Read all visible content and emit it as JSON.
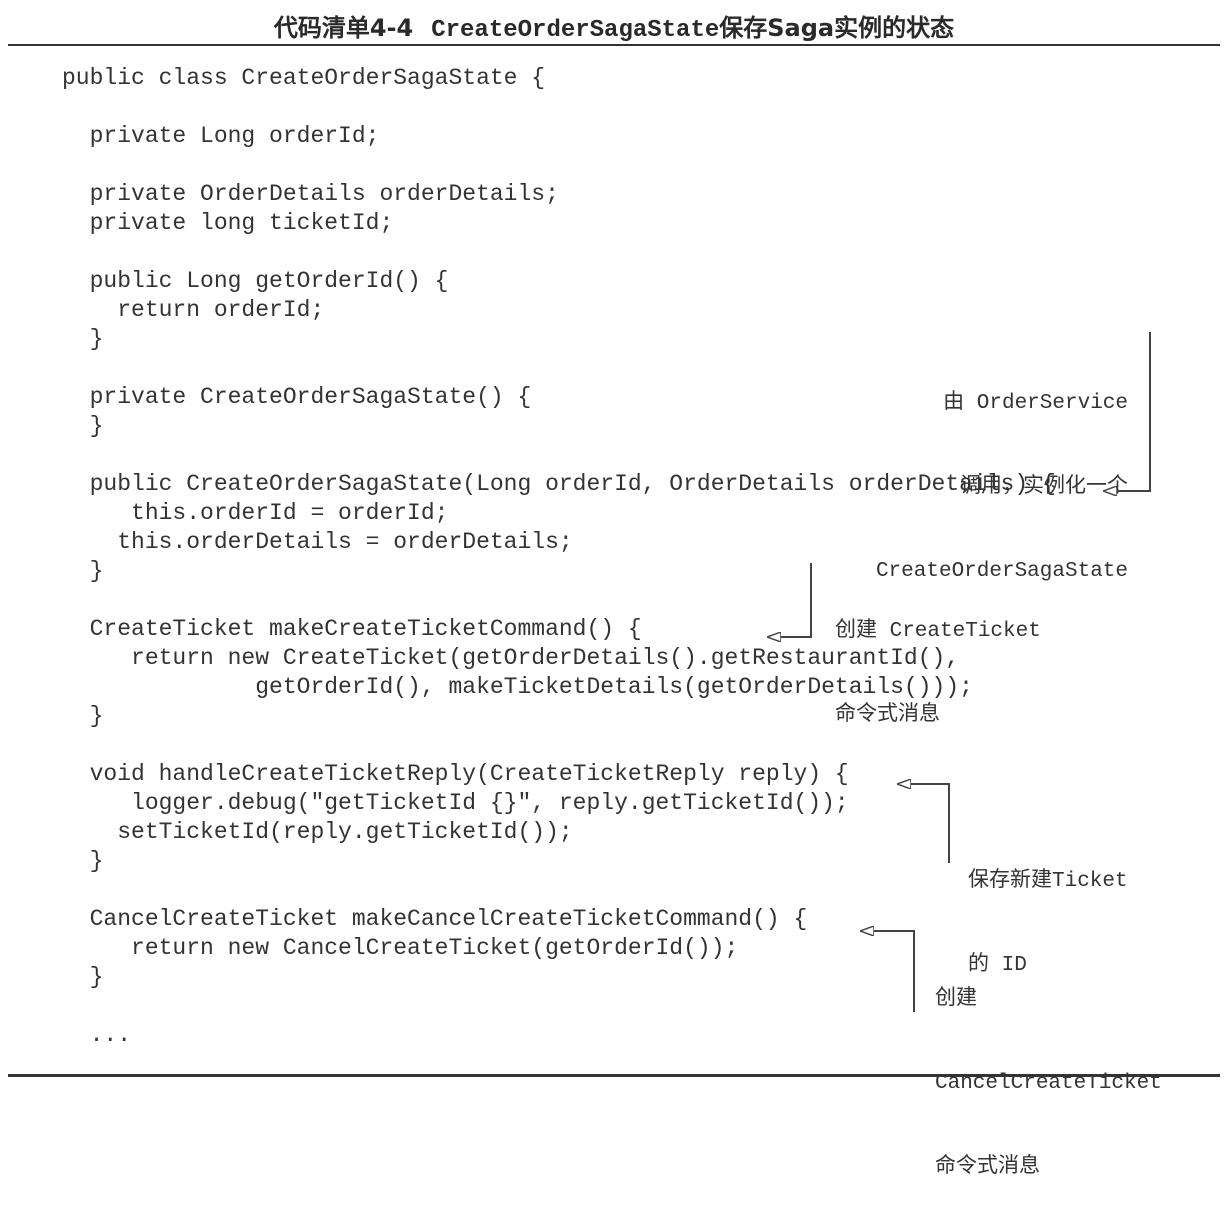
{
  "title": {
    "prefix": "代码清单4-4",
    "classname": "CreateOrderSagaState",
    "suffix_a": "保存",
    "suffix_b": "Saga",
    "suffix_c": "实例的状态"
  },
  "code_lines": [
    {
      "text": "public class CreateOrderSagaState {"
    },
    {
      "text": ""
    },
    {
      "text": "  private Long orderId;"
    },
    {
      "text": ""
    },
    {
      "text": "  private OrderDetails orderDetails;"
    },
    {
      "text": "  private long ticketId;"
    },
    {
      "text": ""
    },
    {
      "text": "  public Long getOrderId() {"
    },
    {
      "text": "    return orderId;"
    },
    {
      "text": "  }"
    },
    {
      "text": ""
    },
    {
      "text": "  private CreateOrderSagaState() {"
    },
    {
      "text": "  }"
    },
    {
      "text": ""
    },
    {
      "text": "  public CreateOrderSagaState(Long orderId, OrderDetails orderDetails) {"
    },
    {
      "text": "     this.orderId = orderId;"
    },
    {
      "text": "    this.orderDetails = orderDetails;"
    },
    {
      "text": "  }"
    },
    {
      "text": ""
    },
    {
      "text": "  CreateTicket makeCreateTicketCommand() {"
    },
    {
      "text": "     return new CreateTicket(getOrderDetails().getRestaurantId(),"
    },
    {
      "text": "              getOrderId(), makeTicketDetails(getOrderDetails()));"
    },
    {
      "text": "  }"
    },
    {
      "text": ""
    },
    {
      "text": "  void handleCreateTicketReply(CreateTicketReply reply) {"
    },
    {
      "text": "     logger.debug(\"getTicketId {}\", reply.getTicketId());"
    },
    {
      "text": "    setTicketId(reply.getTicketId());"
    },
    {
      "text": "  }"
    },
    {
      "text": ""
    },
    {
      "text": "  CancelCreateTicket makeCancelCreateTicketCommand() {"
    },
    {
      "text": "     return new CancelCreateTicket(getOrderId());"
    },
    {
      "text": "  }"
    },
    {
      "text": ""
    },
    {
      "text": "  ..."
    }
  ],
  "annotations": [
    {
      "id": "constructor-note",
      "lines": [
        "由 OrderService",
        "调用，实例化一个",
        "CreateOrderSagaState"
      ]
    },
    {
      "id": "create-ticket-note",
      "lines": [
        "创建 CreateTicket",
        "命令式消息"
      ]
    },
    {
      "id": "save-ticket-note",
      "lines": [
        "保存新建Ticket",
        "的 ID"
      ]
    },
    {
      "id": "cancel-ticket-note",
      "lines": [
        "创建",
        "CancelCreateTicket",
        "命令式消息"
      ]
    }
  ]
}
